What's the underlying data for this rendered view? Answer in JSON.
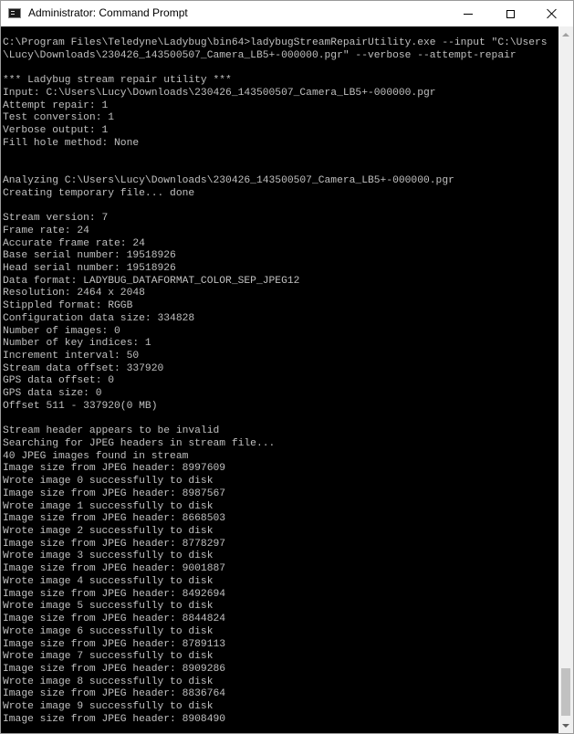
{
  "window": {
    "title": "Administrator: Command Prompt",
    "icon": "command-prompt-icon",
    "controls": [
      "minimize-icon",
      "maximize-icon",
      "close-icon"
    ]
  },
  "console": {
    "background": "#000000",
    "text_color": "#c0c0c0",
    "lines": [
      "C:\\Program Files\\Teledyne\\Ladybug\\bin64>ladybugStreamRepairUtility.exe --input \"C:\\Users",
      "\\Lucy\\Downloads\\230426_143500507_Camera_LB5+-000000.pgr\" --verbose --attempt-repair",
      "",
      "*** Ladybug stream repair utility ***",
      "Input: C:\\Users\\Lucy\\Downloads\\230426_143500507_Camera_LB5+-000000.pgr",
      "Attempt repair: 1",
      "Test conversion: 1",
      "Verbose output: 1",
      "Fill hole method: None",
      "",
      "",
      "Analyzing C:\\Users\\Lucy\\Downloads\\230426_143500507_Camera_LB5+-000000.pgr",
      "Creating temporary file... done",
      "",
      "Stream version: 7",
      "Frame rate: 24",
      "Accurate frame rate: 24",
      "Base serial number: 19518926",
      "Head serial number: 19518926",
      "Data format: LADYBUG_DATAFORMAT_COLOR_SEP_JPEG12",
      "Resolution: 2464 x 2048",
      "Stippled format: RGGB",
      "Configuration data size: 334828",
      "Number of images: 0",
      "Number of key indices: 1",
      "Increment interval: 50",
      "Stream data offset: 337920",
      "GPS data offset: 0",
      "GPS data size: 0",
      "Offset 511 - 337920(0 MB)",
      "",
      "Stream header appears to be invalid",
      "Searching for JPEG headers in stream file...",
      "40 JPEG images found in stream",
      "Image size from JPEG header: 8997609",
      "Wrote image 0 successfully to disk",
      "Image size from JPEG header: 8987567",
      "Wrote image 1 successfully to disk",
      "Image size from JPEG header: 8668503",
      "Wrote image 2 successfully to disk",
      "Image size from JPEG header: 8778297",
      "Wrote image 3 successfully to disk",
      "Image size from JPEG header: 9001887",
      "Wrote image 4 successfully to disk",
      "Image size from JPEG header: 8492694",
      "Wrote image 5 successfully to disk",
      "Image size from JPEG header: 8844824",
      "Wrote image 6 successfully to disk",
      "Image size from JPEG header: 8789113",
      "Wrote image 7 successfully to disk",
      "Image size from JPEG header: 8909286",
      "Wrote image 8 successfully to disk",
      "Image size from JPEG header: 8836764",
      "Wrote image 9 successfully to disk",
      "Image size from JPEG header: 8908490"
    ]
  },
  "scrollbar": {
    "up_icon": "scroll-up-arrow-icon",
    "down_icon": "scroll-down-arrow-icon"
  }
}
